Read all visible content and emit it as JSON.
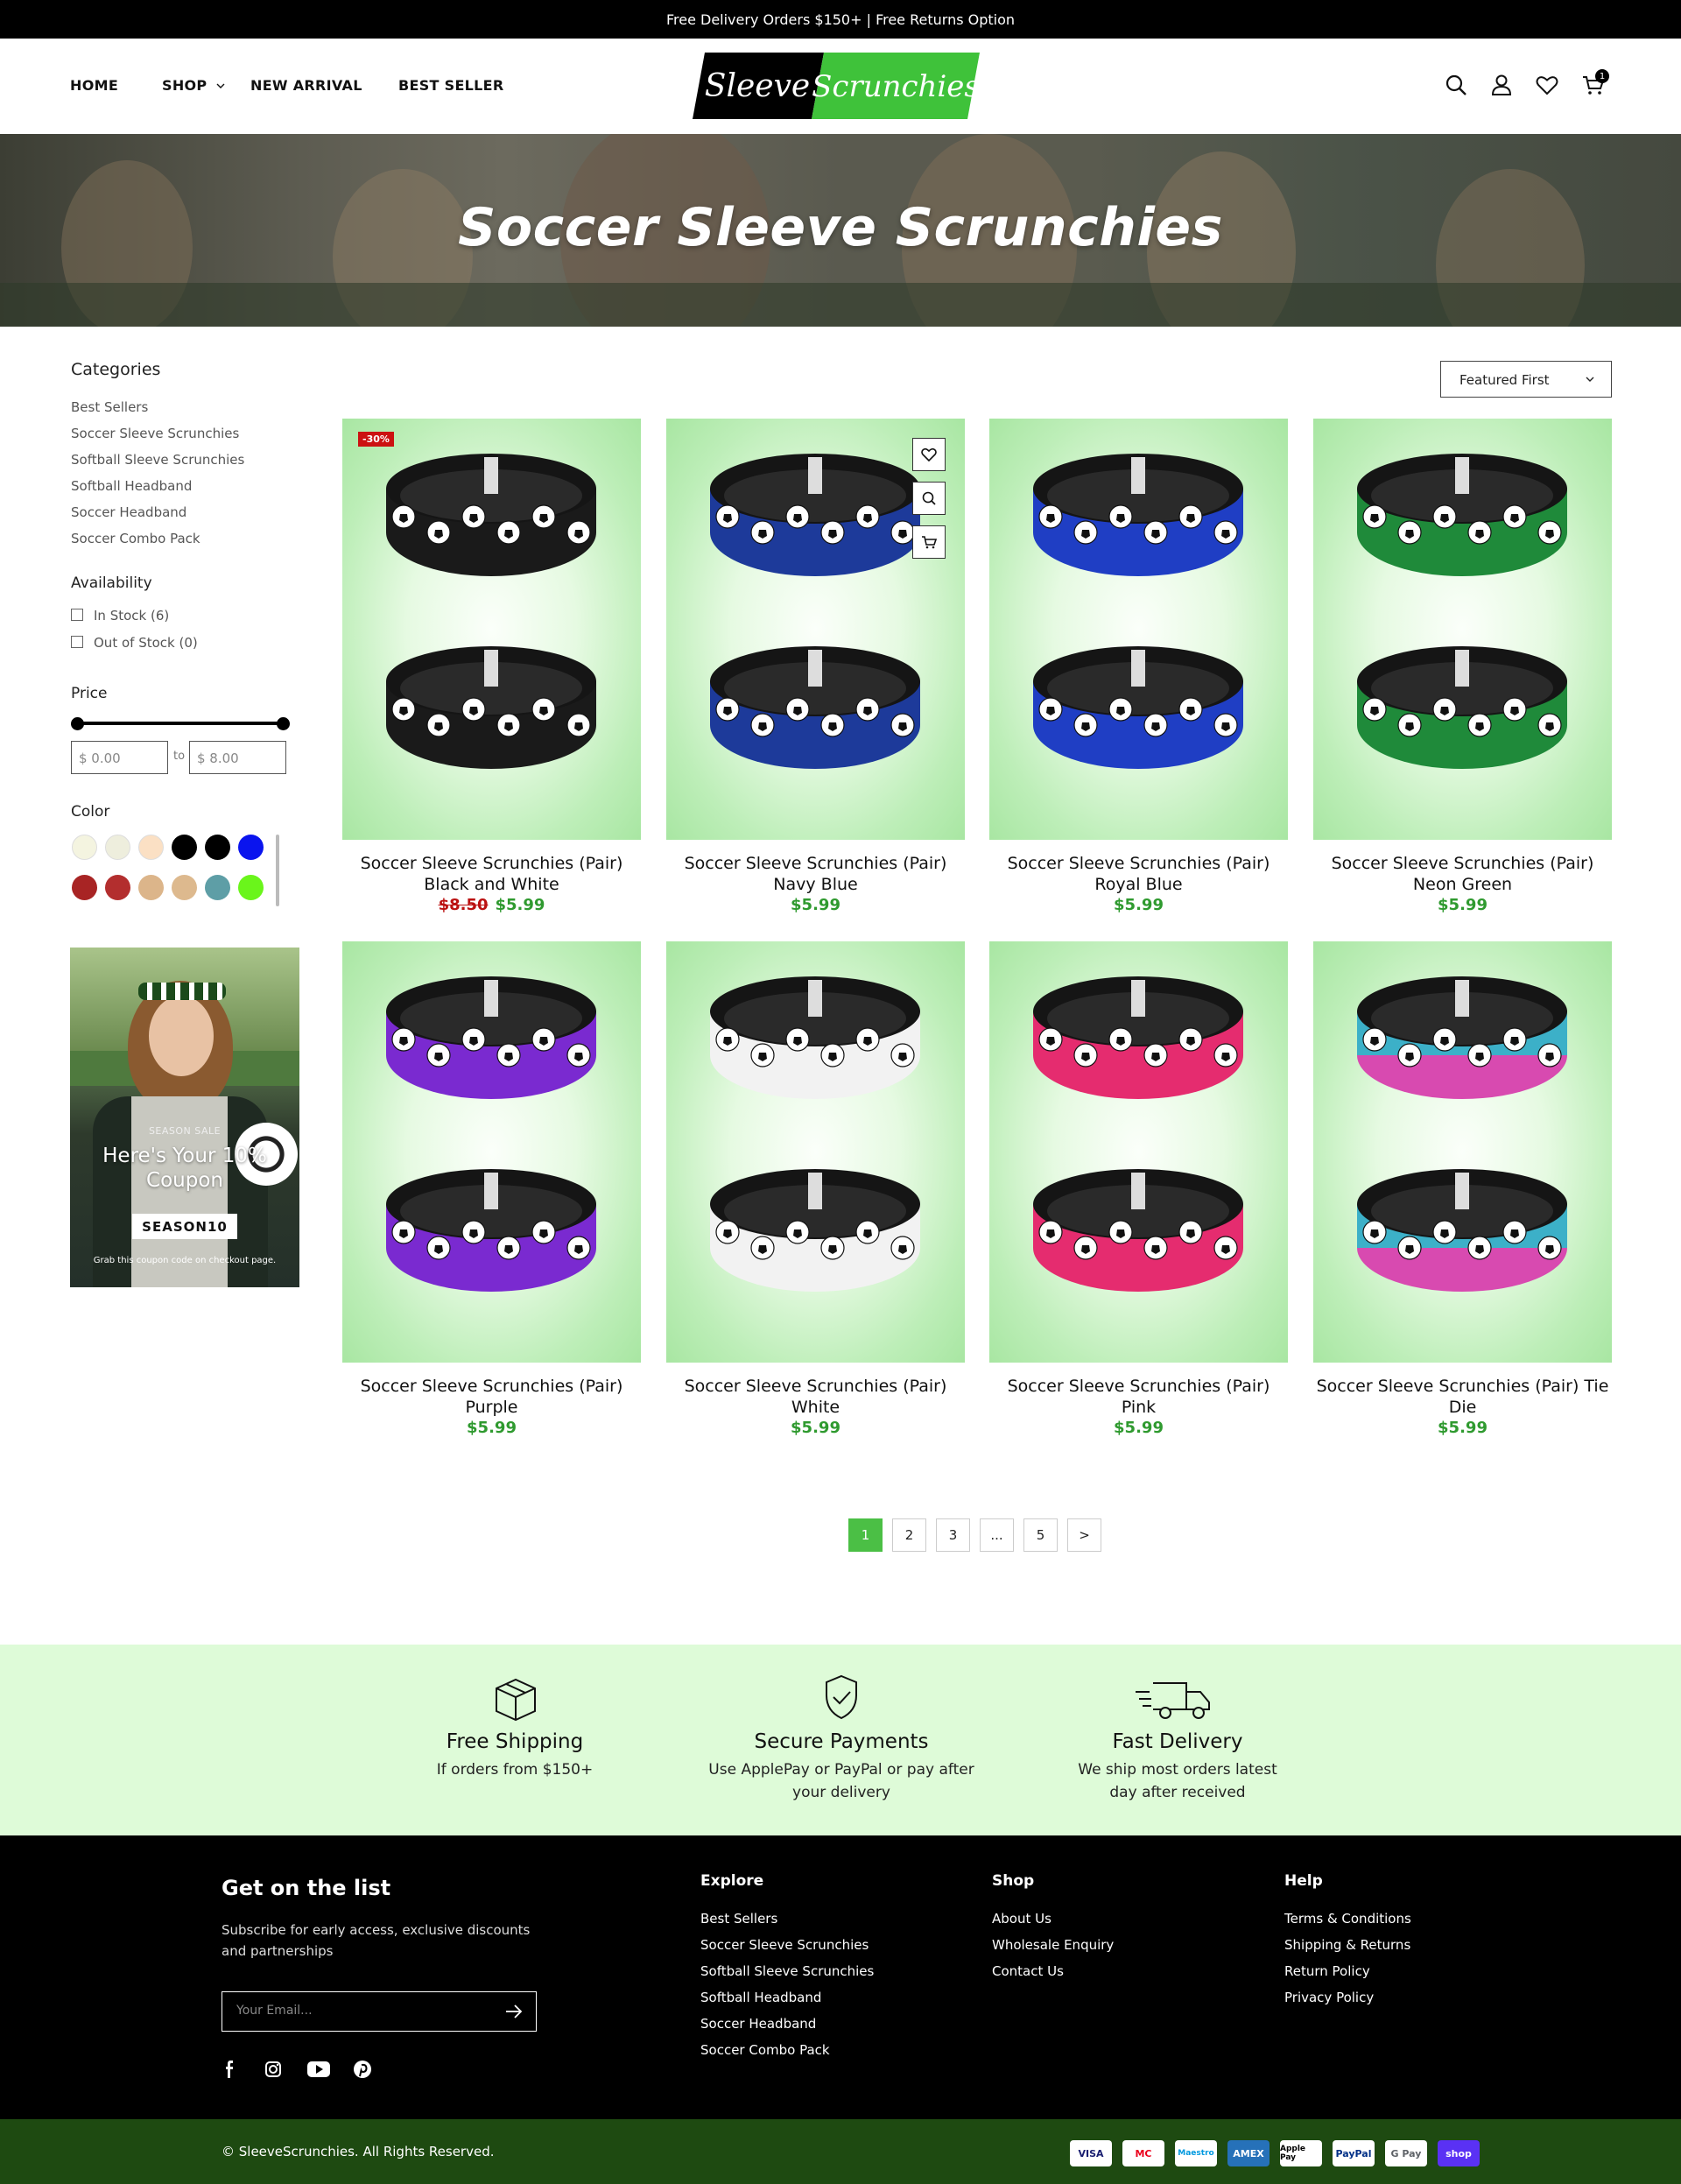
{
  "announcement": "Free Delivery Orders $150+  |  Free Returns Option",
  "nav": {
    "home": "HOME",
    "shop": "SHOP",
    "new_arrival": "NEW ARRIVAL",
    "best_seller": "BEST SELLER"
  },
  "logo": {
    "left": "Sleeve",
    "right": "Scrunchies"
  },
  "cart_count": "1",
  "hero_title": "Soccer Sleeve Scrunchies",
  "sidebar": {
    "categories_title": "Categories",
    "categories": [
      "Best Sellers",
      "Soccer Sleeve Scrunchies",
      "Softball Sleeve Scrunchies",
      "Softball Headband",
      "Soccer Headband",
      "Soccer Combo Pack"
    ],
    "availability_title": "Availability",
    "in_stock": "In Stock (6)",
    "out_of_stock": "Out of Stock (0)",
    "price_title": "Price",
    "price_min_placeholder": "$ 0.00",
    "price_to": "to",
    "price_max_placeholder": "$ 8.00",
    "color_title": "Color",
    "colors": [
      "#f4f4e0",
      "#eeeedd",
      "#fbe0c4",
      "#000000",
      "#000000",
      "#0a14ee",
      "#a82424",
      "#b32e2e",
      "#dcb58a",
      "#ddb98e",
      "#5e9ea6",
      "#6af51b"
    ]
  },
  "promo": {
    "kicker": "SEASON SALE",
    "headline": "Here's Your 10% Coupon",
    "code": "SEASON10",
    "note": "Grab this coupon code on checkout page."
  },
  "sort_label": "Featured First",
  "products": [
    {
      "title": "Soccer Sleeve Scrunchies (Pair) Black and White",
      "old_price": "$8.50",
      "price": "$5.99",
      "badge": "-30%",
      "color": "#1a1a1a",
      "ball": "#fff"
    },
    {
      "title": "Soccer Sleeve Scrunchies (Pair) Navy Blue",
      "old_price": "",
      "price": "$5.99",
      "badge": "",
      "color": "#1d3a9a",
      "ball": "#fff"
    },
    {
      "title": "Soccer Sleeve Scrunchies (Pair) Royal Blue",
      "old_price": "",
      "price": "$5.99",
      "badge": "",
      "color": "#1f3ec4",
      "ball": "#fff"
    },
    {
      "title": "Soccer Sleeve Scrunchies (Pair) Neon Green",
      "old_price": "",
      "price": "$5.99",
      "badge": "",
      "color": "#1f8a3a",
      "ball": "#fff"
    },
    {
      "title": "Soccer Sleeve Scrunchies (Pair) Purple",
      "old_price": "",
      "price": "$5.99",
      "badge": "",
      "color": "#7a2ad0",
      "ball": "#fff"
    },
    {
      "title": "Soccer Sleeve Scrunchies (Pair) White",
      "old_price": "",
      "price": "$5.99",
      "badge": "",
      "color": "#f2f2f2",
      "ball": "#222"
    },
    {
      "title": "Soccer Sleeve Scrunchies (Pair) Pink",
      "old_price": "",
      "price": "$5.99",
      "badge": "",
      "color": "#e52c6f",
      "ball": "#fff"
    },
    {
      "title": "Soccer Sleeve Scrunchies (Pair) Tie Die",
      "old_price": "",
      "price": "$5.99",
      "badge": "",
      "color": "#3cb0c8",
      "ball": "#fff"
    }
  ],
  "pagination": [
    "1",
    "2",
    "3",
    "...",
    "5",
    ">"
  ],
  "features": [
    {
      "title": "Free Shipping",
      "sub": "If orders from $150+"
    },
    {
      "title": "Secure Payments",
      "sub": "Use ApplePay or PayPal or pay after your delivery"
    },
    {
      "title": "Fast Delivery",
      "sub": "We ship most orders latest day after received"
    }
  ],
  "footer": {
    "newsletter_title": "Get on the list",
    "newsletter_text": "Subscribe for early access, exclusive discounts and partnerships",
    "email_placeholder": "Your Email...",
    "explore_title": "Explore",
    "explore": [
      "Best Sellers",
      "Soccer Sleeve Scrunchies",
      "Softball Sleeve Scrunchies",
      "Softball Headband",
      "Soccer Headband",
      "Soccer Combo Pack"
    ],
    "shop_title": "Shop",
    "shop": [
      "About Us",
      "Wholesale Enquiry",
      "Contact Us"
    ],
    "help_title": "Help",
    "help": [
      "Terms & Conditions",
      "Shipping & Returns",
      "Return Policy",
      "Privacy Policy"
    ],
    "copyright": "© SleeveScrunchies. All Rights Reserved.",
    "payments": [
      "VISA",
      "MC",
      "Maestro",
      "AMEX",
      "Apple Pay",
      "PayPal",
      "G Pay",
      "shop"
    ]
  }
}
